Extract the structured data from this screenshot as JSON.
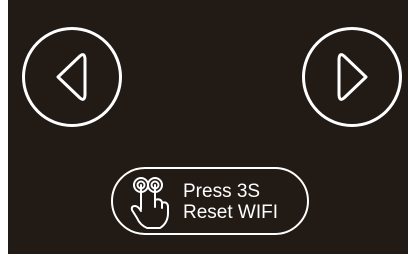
{
  "controls": {
    "previous": {
      "icon": "chevron-left-icon"
    },
    "next": {
      "icon": "chevron-right-icon"
    },
    "reset_wifi": {
      "icon": "two-finger-touch-icon",
      "line1": "Press 3S",
      "line2": "Reset WIFI"
    }
  },
  "colors": {
    "background": "#221a15",
    "foreground": "#ffffff"
  }
}
